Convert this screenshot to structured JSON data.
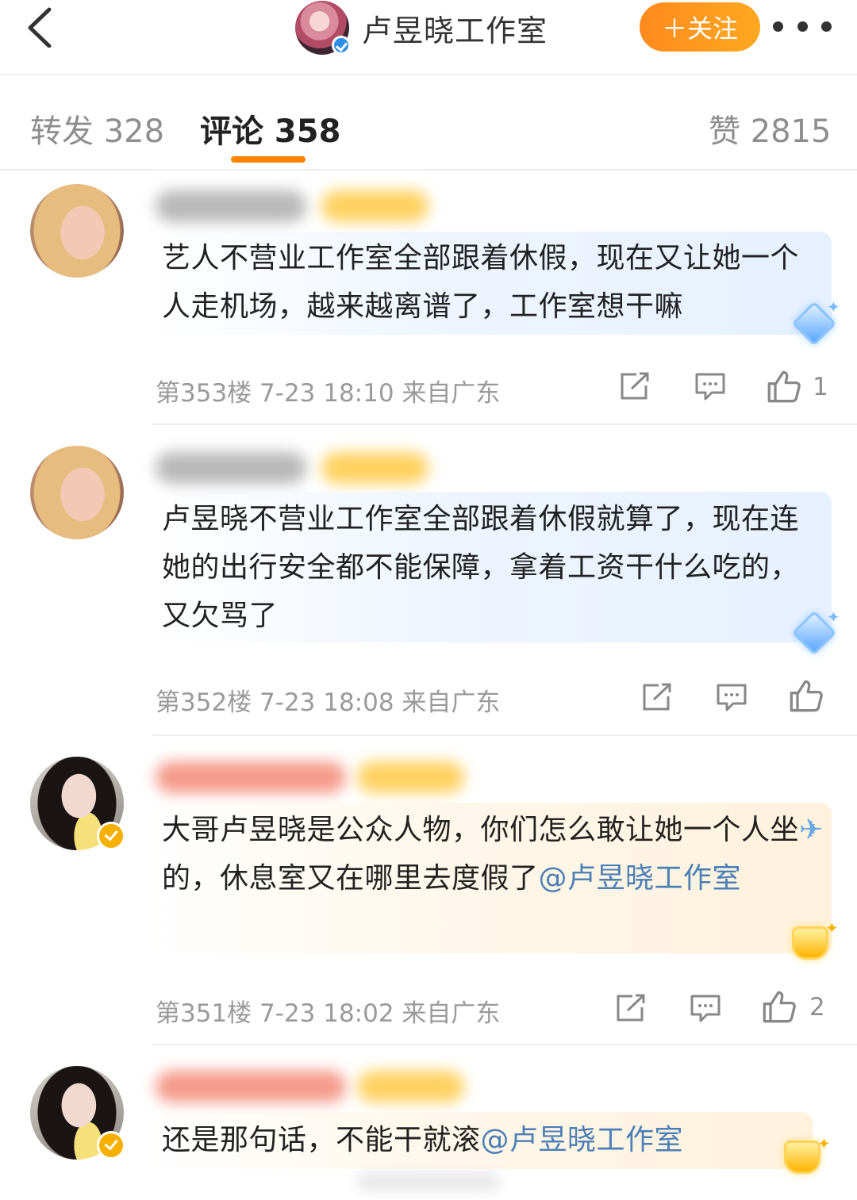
{
  "header": {
    "back_icon": "chevron-left-icon",
    "account_name": "卢昱晓工作室",
    "follow_label": "＋关注",
    "more_icon": "more-dots-icon",
    "accent_color": "#ff8200"
  },
  "tabs": {
    "repost": "转发 328",
    "comments": "评论 358",
    "likes": "赞 2815"
  },
  "comments": [
    {
      "text": "艺人不营业工作室全部跟着休假，现在又让她一个人走机场，越来越离谱了，工作室想干嘛",
      "meta": "第353楼  7-23 18:10  来自广东",
      "likes": "1"
    },
    {
      "text": "卢昱晓不营业工作室全部跟着休假就算了，现在连她的出行安全都不能保障，拿着工资干什么吃的，又欠骂了",
      "meta": "第352楼  7-23 18:08  来自广东",
      "likes": ""
    },
    {
      "text_before": "大哥卢昱晓是公众人物，你们怎么敢让她一个人坐",
      "emoji": "✈",
      "text_after": "的，休息室又在哪里去度假了",
      "mention": "@卢昱晓工作室",
      "meta": "第351楼  7-23 18:02  来自广东",
      "likes": "2"
    },
    {
      "text": "还是那句话，不能干就滚",
      "mention": "@卢昱晓工作室"
    }
  ],
  "icons": {
    "share": "share-icon",
    "reply": "comment-icon",
    "like": "thumbs-up-icon"
  }
}
